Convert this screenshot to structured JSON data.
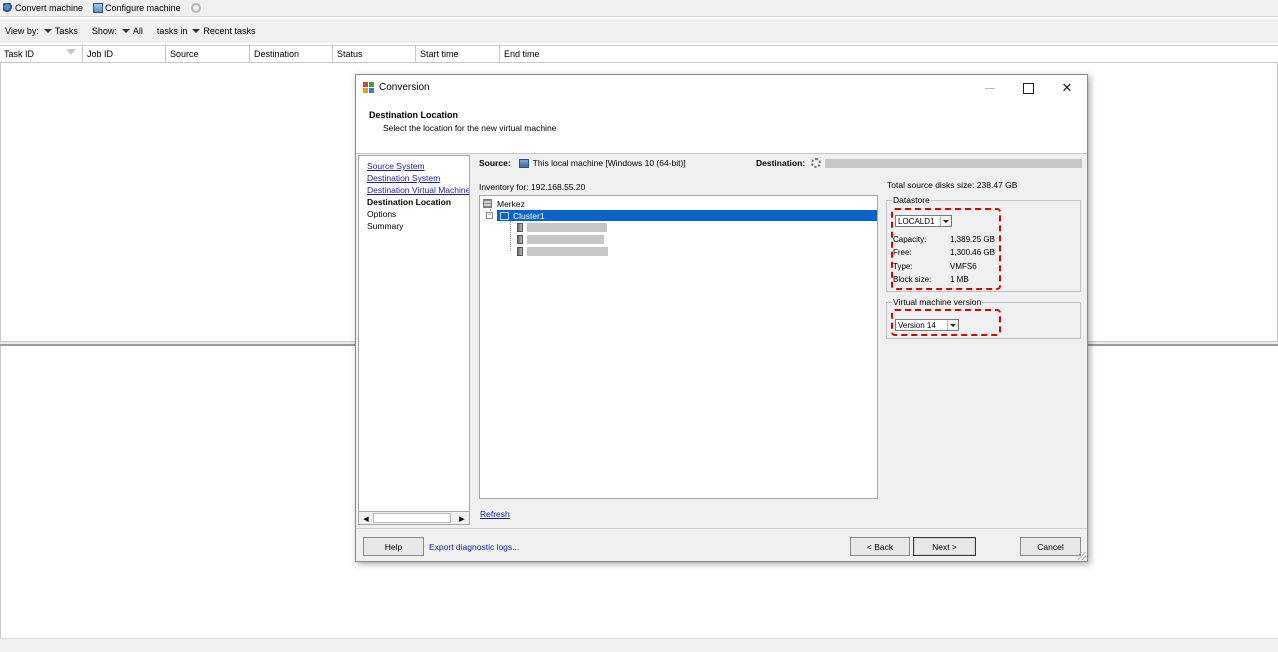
{
  "toolbar": {
    "convert_label": "Convert machine",
    "configure_label": "Configure machine"
  },
  "viewbar": {
    "view_by_label": "View by:",
    "view_by_value": "Tasks",
    "show_label": "Show:",
    "show_value": "All",
    "tasks_in_label": "tasks in",
    "tasks_in_value": "Recent tasks"
  },
  "task_table": {
    "columns": [
      "Task ID",
      "Job ID",
      "Source",
      "Destination",
      "Status",
      "Start time",
      "End time"
    ]
  },
  "dialog": {
    "title": "Conversion",
    "heading": "Destination Location",
    "subheading": "Select the location for the new virtual machine",
    "nav": [
      {
        "label": "Source System"
      },
      {
        "label": "Destination System"
      },
      {
        "label": "Destination Virtual Machine"
      },
      {
        "label": "Destination Location"
      },
      {
        "label": "Options"
      },
      {
        "label": "Summary"
      }
    ],
    "source_label": "Source:",
    "source_value": "This local machine [Windows 10 (64-bit)]",
    "destination_label": "Destination:",
    "inventory_label": "Inventory for:",
    "inventory_host": "192.168.55.20",
    "tree": {
      "datacenter": "Merkez",
      "cluster": "Cluster1"
    },
    "refresh_label": "Refresh",
    "total_disk_label": "Total source disks size:",
    "total_disk_value": "238.47 GB",
    "datastore": {
      "group_title": "Datastore",
      "selected": "LOCALD1",
      "capacity_label": "Capacity:",
      "capacity_value": "1,389.25 GB",
      "free_label": "Free:",
      "free_value": "1,300.46 GB",
      "type_label": "Type:",
      "type_value": "VMFS6",
      "block_label": "Block size:",
      "block_value": "1 MB"
    },
    "vm_version": {
      "group_title": "Virtual machine version",
      "selected": "Version 14"
    },
    "buttons": {
      "help": "Help",
      "export": "Export diagnostic logs...",
      "back": "< Back",
      "next": "Next >",
      "cancel": "Cancel"
    },
    "close_glyph": "✕"
  },
  "colors": {
    "selection": "#0a64c8",
    "link": "#1a1aa6",
    "highlight": "#e00000"
  },
  "icons": [
    "convert-machine-icon",
    "configure-machine-icon",
    "refresh-icon",
    "conversion-app-icon",
    "computer-icon",
    "gear-icon",
    "datacenter-icon",
    "cluster-icon",
    "host-icon"
  ]
}
